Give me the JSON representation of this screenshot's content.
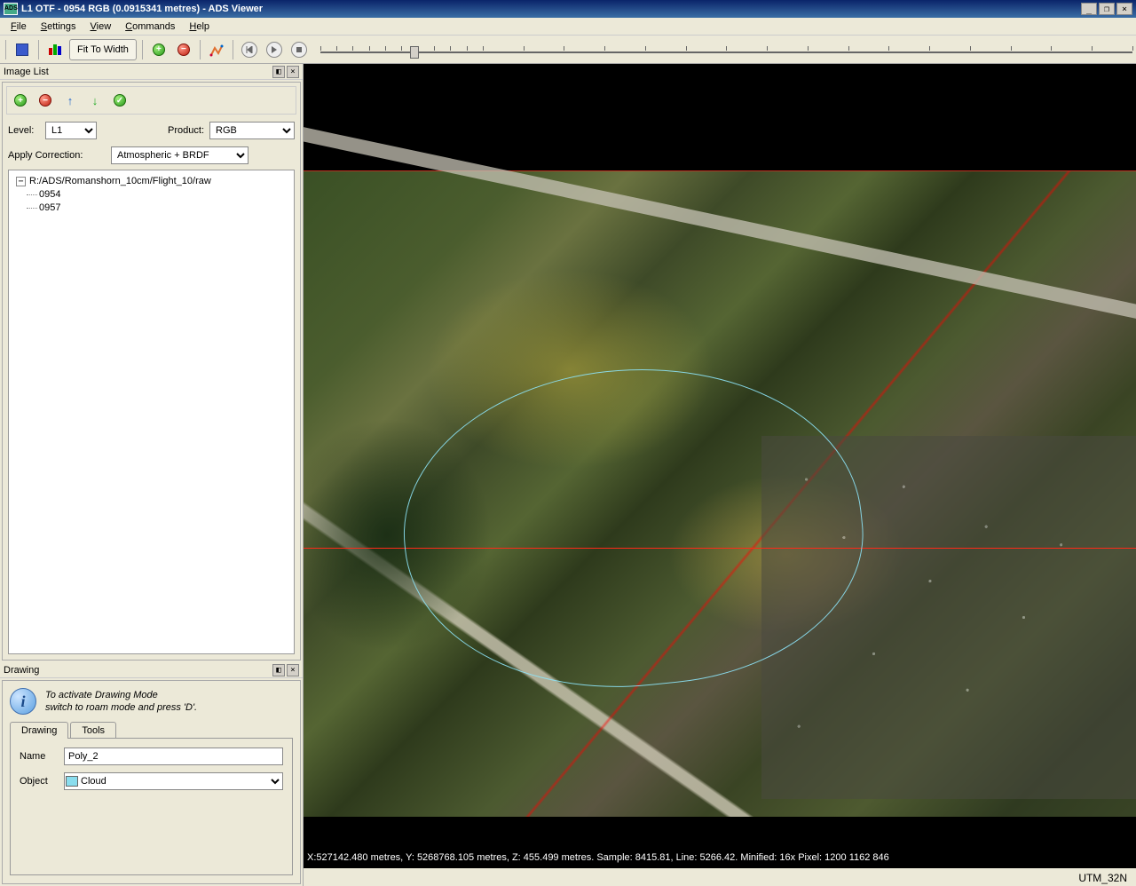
{
  "window": {
    "title": "L1 OTF - 0954 RGB (0.0915341 metres) - ADS Viewer",
    "app_icon_text": "ADS"
  },
  "menu": {
    "file": "File",
    "settings": "Settings",
    "view": "View",
    "commands": "Commands",
    "help": "Help"
  },
  "toolbar": {
    "fit_to_width": "Fit To Width"
  },
  "image_list": {
    "title": "Image List",
    "level_label": "Level:",
    "level_value": "L1",
    "product_label": "Product:",
    "product_value": "RGB",
    "correction_label": "Apply Correction:",
    "correction_value": "Atmospheric + BRDF",
    "tree_root": "R:/ADS/Romanshorn_10cm/Flight_10/raw",
    "tree_children": [
      "0954",
      "0957"
    ]
  },
  "drawing": {
    "title": "Drawing",
    "info_line1": "To activate Drawing Mode",
    "info_line2": "switch to roam mode and press 'D'.",
    "tab_drawing": "Drawing",
    "tab_tools": "Tools",
    "name_label": "Name",
    "name_value": "Poly_2",
    "object_label": "Object",
    "object_value": "Cloud"
  },
  "status": {
    "coords": "X:527142.480 metres, Y: 5268768.105 metres, Z: 455.499 metres. Sample: 8415.81, Line: 5266.42. Minified: 16x Pixel: 1200 1162 846",
    "projection": "UTM_32N"
  }
}
